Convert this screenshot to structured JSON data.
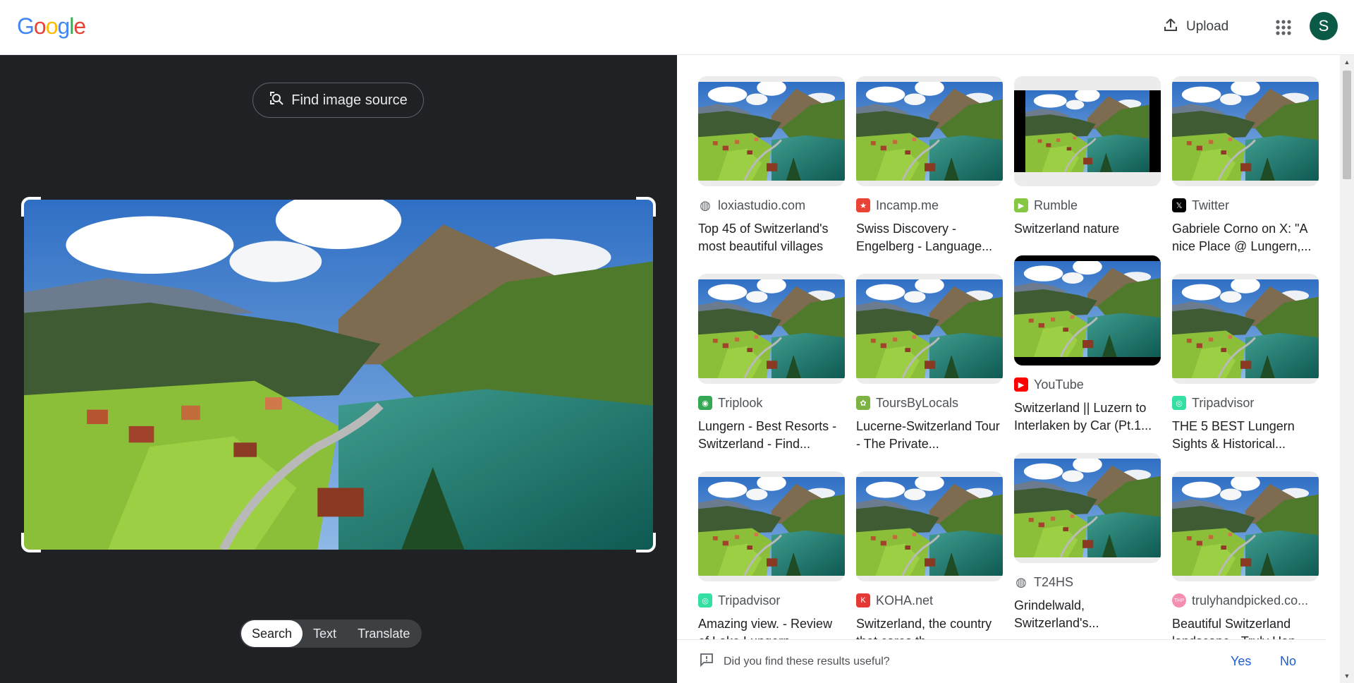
{
  "header": {
    "logo_letters": [
      {
        "char": "G",
        "color": "#4285F4"
      },
      {
        "char": "o",
        "color": "#EA4335"
      },
      {
        "char": "o",
        "color": "#FBBC05"
      },
      {
        "char": "g",
        "color": "#4285F4"
      },
      {
        "char": "l",
        "color": "#34A853"
      },
      {
        "char": "e",
        "color": "#EA4335"
      }
    ],
    "upload_label": "Upload",
    "upload_icon": "upload-icon",
    "apps_icon": "apps-grid-icon",
    "avatar_letter": "S"
  },
  "left": {
    "find_source_label": "Find image source",
    "find_source_icon": "lens-search-icon",
    "tabs": [
      {
        "label": "Search",
        "active": true
      },
      {
        "label": "Text",
        "active": false
      },
      {
        "label": "Translate",
        "active": false
      }
    ]
  },
  "results": {
    "columns": [
      [
        {
          "source": "loxiastudio.com",
          "favicon": "globe-icon",
          "favicon_color": "#5f6368",
          "title": "Top 45 of Switzerland's most beautiful villages",
          "thumb": "fill"
        },
        {
          "source": "Triplook",
          "favicon": "triplook-icon",
          "favicon_color": "#34a853",
          "title": "Lungern - Best Resorts - Switzerland - Find...",
          "thumb": "fill"
        },
        {
          "source": "Tripadvisor",
          "favicon": "tripadvisor-icon",
          "favicon_color": "#34e0a1",
          "title": "Amazing view. - Review of Lake Lungern...",
          "thumb": "fill"
        }
      ],
      [
        {
          "source": "Incamp.me",
          "favicon": "star-icon",
          "favicon_color": "#ea4335",
          "title": "Swiss Discovery - Engelberg - Language...",
          "thumb": "fill"
        },
        {
          "source": "ToursByLocals",
          "favicon": "toursbylocals-icon",
          "favicon_color": "#7cb342",
          "title": "Lucerne-Switzerland Tour - The Private...",
          "thumb": "fill"
        },
        {
          "source": "KOHA.net",
          "favicon": "koha-icon",
          "favicon_color": "#e53935",
          "title": "Switzerland, the country that cares th...",
          "thumb": "fill"
        }
      ],
      [
        {
          "source": "Rumble",
          "favicon": "rumble-icon",
          "favicon_color": "#85c742",
          "title": "Switzerland nature",
          "thumb": "letterbox"
        },
        {
          "source": "YouTube",
          "favicon": "youtube-icon",
          "favicon_color": "#ff0000",
          "title": "Switzerland || Luzern to Interlaken by Car (Pt.1...",
          "thumb": "bars"
        },
        {
          "source": "T24HS",
          "favicon": "globe-icon",
          "favicon_color": "#5f6368",
          "title": "Grindelwald, Switzerland's...",
          "thumb": "fill"
        }
      ],
      [
        {
          "source": "Twitter",
          "favicon": "x-icon",
          "favicon_color": "#000000",
          "title": "Gabriele Corno on X: \"A nice Place @ Lungern,...",
          "thumb": "fill"
        },
        {
          "source": "Tripadvisor",
          "favicon": "tripadvisor-icon",
          "favicon_color": "#34e0a1",
          "title": "THE 5 BEST Lungern Sights & Historical...",
          "thumb": "fill"
        },
        {
          "source": "trulyhandpicked.co...",
          "favicon": "thp-icon",
          "favicon_color": "#f48fb1",
          "title": "Beautiful Switzerland landscape - Truly Han...",
          "thumb": "fill"
        }
      ]
    ]
  },
  "feedback": {
    "question": "Did you find these results useful?",
    "yes_label": "Yes",
    "no_label": "No",
    "icon": "feedback-icon"
  }
}
